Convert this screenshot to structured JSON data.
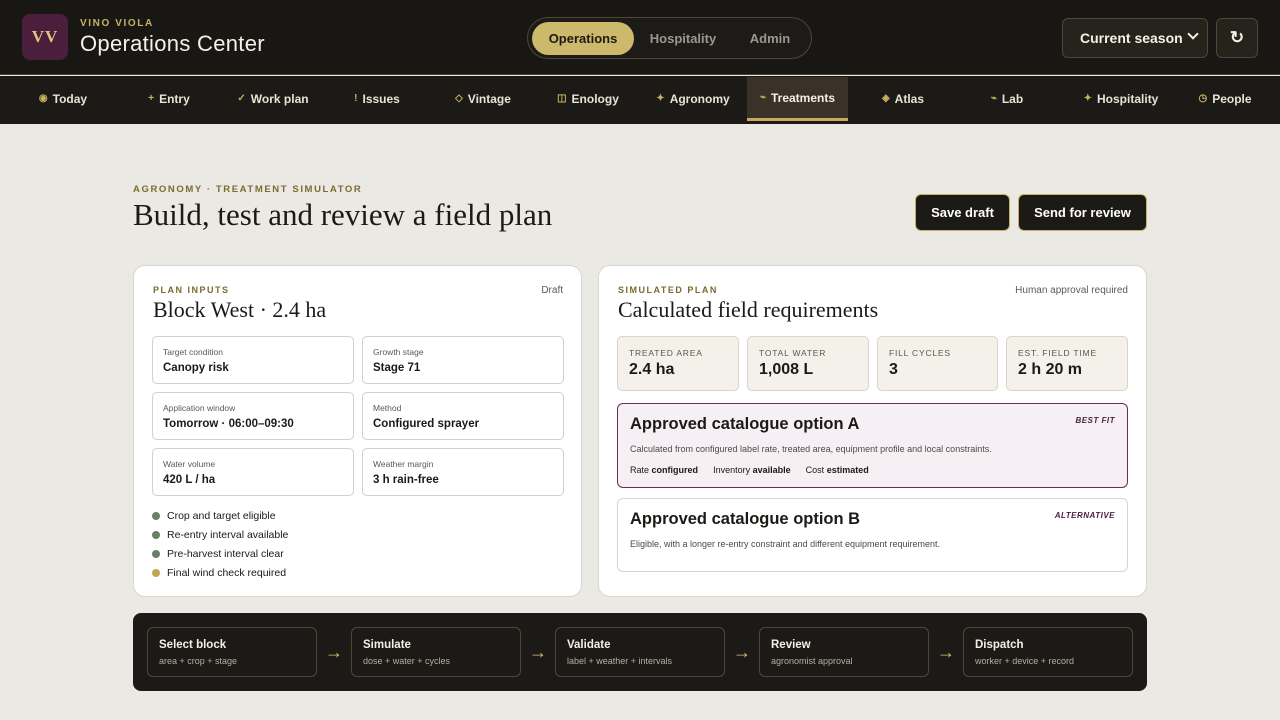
{
  "app": {
    "logo_text": "VV",
    "brand_small": "VINO VIOLA",
    "title": "Operations Center"
  },
  "modes": [
    {
      "label": "Operations",
      "active": true
    },
    {
      "label": "Hospitality",
      "active": false
    },
    {
      "label": "Admin",
      "active": false
    }
  ],
  "season_select": {
    "value": "Current season"
  },
  "refresh": {
    "icon": "refresh-icon",
    "glyph": "↻"
  },
  "nav": [
    {
      "label": "Today",
      "icon": "◉",
      "icon_name": "today-icon"
    },
    {
      "label": "Entry",
      "icon": "+",
      "icon_name": "plus-icon"
    },
    {
      "label": "Work plan",
      "icon": "✓",
      "icon_name": "check-icon"
    },
    {
      "label": "Issues",
      "icon": "!",
      "icon_name": "alert-icon"
    },
    {
      "label": "Vintage",
      "icon": "◇",
      "icon_name": "diamond-icon"
    },
    {
      "label": "Enology",
      "icon": "◫",
      "icon_name": "enology-icon"
    },
    {
      "label": "Agronomy",
      "icon": "✦",
      "icon_name": "agronomy-icon"
    },
    {
      "label": "Treatments",
      "icon": "⌁",
      "icon_name": "treatments-icon",
      "active": true
    },
    {
      "label": "Atlas",
      "icon": "◈",
      "icon_name": "atlas-icon"
    },
    {
      "label": "Lab",
      "icon": "⌁",
      "icon_name": "lab-icon"
    },
    {
      "label": "Hospitality",
      "icon": "✦",
      "icon_name": "hospitality-icon"
    },
    {
      "label": "People",
      "icon": "◷",
      "icon_name": "people-icon"
    }
  ],
  "header": {
    "eyebrow": "AGRONOMY · TREATMENT SIMULATOR",
    "title": "Build, test and review a field plan",
    "save_label": "Save draft",
    "send_label": "Send for review"
  },
  "plan_inputs": {
    "eyebrow": "PLAN INPUTS",
    "status": "Draft",
    "title": "Block West · 2.4 ha",
    "fields": [
      {
        "label": "Target condition",
        "value": "Canopy risk"
      },
      {
        "label": "Growth stage",
        "value": "Stage 71"
      },
      {
        "label": "Application window",
        "value": "Tomorrow · 06:00–09:30"
      },
      {
        "label": "Method",
        "value": "Configured sprayer"
      },
      {
        "label": "Water volume",
        "value": "420 L / ha"
      },
      {
        "label": "Weather margin",
        "value": "3 h rain-free"
      }
    ],
    "checks": [
      {
        "text": "Crop and target eligible",
        "status": "ok"
      },
      {
        "text": "Re-entry interval available",
        "status": "ok"
      },
      {
        "text": "Pre-harvest interval clear",
        "status": "ok"
      },
      {
        "text": "Final wind check required",
        "status": "warn"
      }
    ]
  },
  "simulated": {
    "eyebrow": "SIMULATED PLAN",
    "note": "Human approval required",
    "title": "Calculated field requirements",
    "metrics": [
      {
        "label": "TREATED AREA",
        "value": "2.4 ha"
      },
      {
        "label": "TOTAL WATER",
        "value": "1,008 L"
      },
      {
        "label": "FILL CYCLES",
        "value": "3"
      },
      {
        "label": "EST. FIELD TIME",
        "value": "2 h 20 m"
      }
    ],
    "option_a": {
      "title": "Approved catalogue option A",
      "tag": "BEST FIT",
      "desc": "Calculated from configured label rate, treated area, equipment profile and local constraints.",
      "rate_label": "Rate",
      "rate_value": "configured",
      "inv_label": "Inventory",
      "inv_value": "available",
      "cost_label": "Cost",
      "cost_value": "estimated"
    },
    "option_b": {
      "title": "Approved catalogue option B",
      "tag": "ALTERNATIVE",
      "desc": "Eligible, with a longer re-entry constraint and different equipment requirement."
    }
  },
  "workflow": {
    "arrow": "→",
    "steps": [
      {
        "title": "Select block",
        "sub": "area + crop + stage"
      },
      {
        "title": "Simulate",
        "sub": "dose + water + cycles"
      },
      {
        "title": "Validate",
        "sub": "label + weather + intervals"
      },
      {
        "title": "Review",
        "sub": "agronomist approval"
      },
      {
        "title": "Dispatch",
        "sub": "worker + device + record"
      }
    ]
  },
  "colors": {
    "accent_gold": "#cdb96c",
    "brand_plum": "#4b1e3d",
    "ok_green": "#6a7f67",
    "warn_gold": "#c4a64f",
    "dark": "#1c1a16"
  }
}
